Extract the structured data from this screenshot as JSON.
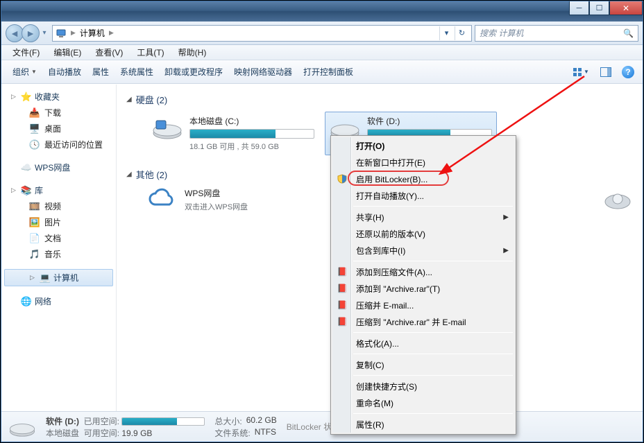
{
  "titlebar": {
    "min": "▭",
    "max": "▢"
  },
  "nav": {
    "breadcrumb_root": "计算机",
    "crumb_sep": "▶",
    "search_placeholder": "搜索 计算机"
  },
  "menubar": {
    "file": "文件(F)",
    "edit": "编辑(E)",
    "view": "查看(V)",
    "tools": "工具(T)",
    "help": "帮助(H)"
  },
  "toolbar": {
    "organize": "组织",
    "autoplay": "自动播放",
    "properties": "属性",
    "sys_properties": "系统属性",
    "uninstall": "卸载或更改程序",
    "map_drive": "映射网络驱动器",
    "control_panel": "打开控制面板"
  },
  "sidebar": {
    "favorites": {
      "label": "收藏夹",
      "items": [
        "下载",
        "桌面",
        "最近访问的位置"
      ]
    },
    "wps": "WPS网盘",
    "libraries": {
      "label": "库",
      "items": [
        "视频",
        "图片",
        "文档",
        "音乐"
      ]
    },
    "computer": "计算机",
    "network": "网络"
  },
  "content": {
    "group_disk": "硬盘 (2)",
    "group_other": "其他 (2)",
    "drive_c": {
      "name": "本地磁盘 (C:)",
      "sub": "18.1 GB 可用 , 共 59.0 GB",
      "fill_pct": 69
    },
    "drive_d": {
      "name": "软件 (D:)",
      "sub": "",
      "fill_pct": 67
    },
    "wps_name": "WPS网盘",
    "wps_sub": "双击进入WPS网盘"
  },
  "context_menu": {
    "open": "打开(O)",
    "open_new": "在新窗口中打开(E)",
    "bitlocker": "启用 BitLocker(B)...",
    "autoplay": "打开自动播放(Y)...",
    "share": "共享(H)",
    "restore": "还原以前的版本(V)",
    "include_lib": "包含到库中(I)",
    "rar_add": "添加到压缩文件(A)...",
    "rar_add_name": "添加到 \"Archive.rar\"(T)",
    "rar_email": "压缩并 E-mail...",
    "rar_email_name": "压缩到 \"Archive.rar\" 并 E-mail",
    "format": "格式化(A)...",
    "copy": "复制(C)",
    "shortcut": "创建快捷方式(S)",
    "rename": "重命名(M)",
    "props": "属性(R)"
  },
  "details": {
    "name": "软件 (D:)",
    "type": "本地磁盘",
    "used_k": "已用空间:",
    "free_k": "可用空间:",
    "free_v": "19.9 GB",
    "total_k": "总大小:",
    "total_v": "60.2 GB",
    "fs_k": "文件系统:",
    "fs_v": "NTFS",
    "bitlocker_status": "BitLocker 状态: 关闭",
    "fill_pct": 67
  }
}
